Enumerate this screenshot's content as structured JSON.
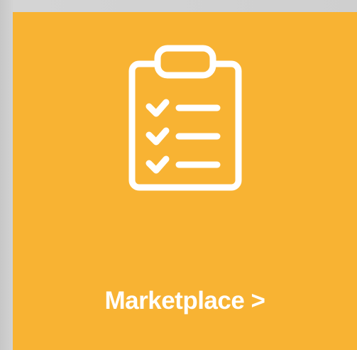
{
  "tile": {
    "label": "Marketplace >",
    "icon": "clipboard-checklist-icon",
    "background_color": "#f8b333",
    "foreground_color": "#ffffff"
  }
}
